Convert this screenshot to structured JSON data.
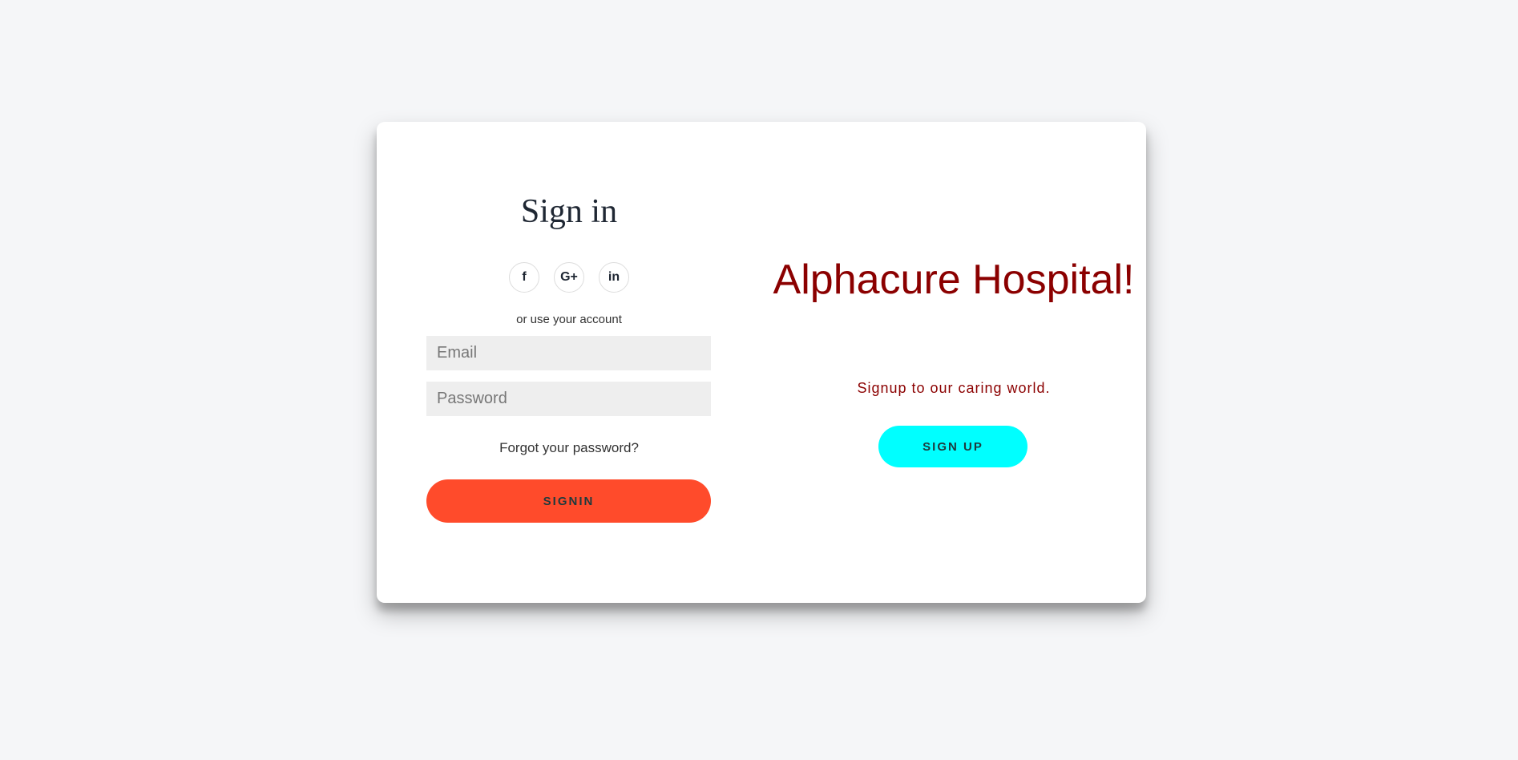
{
  "signin": {
    "title": "Sign in",
    "socials": [
      {
        "icon": "facebook-icon",
        "glyph": "f"
      },
      {
        "icon": "google-plus-icon",
        "glyph": "G+"
      },
      {
        "icon": "linkedin-icon",
        "glyph": "in"
      }
    ],
    "alt_text": "or use your account",
    "email_placeholder": "Email",
    "password_placeholder": "Password",
    "forgot_label": "Forgot your password?",
    "button_label": "SIGNIN"
  },
  "overlay": {
    "brand": "Alphacure Hospital!",
    "tagline": "Signup to our caring world.",
    "button_label": "SIGN UP"
  },
  "colors": {
    "background": "#f5f6f8",
    "signin_button": "#ff4b2b",
    "signup_button": "#00ffff",
    "brand": "#8b0000"
  }
}
